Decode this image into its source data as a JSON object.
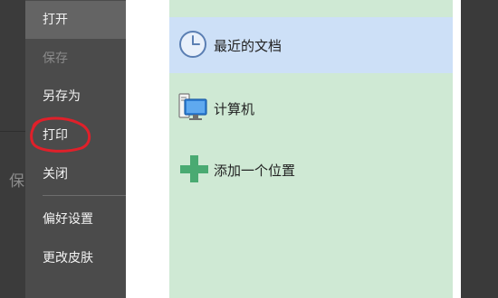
{
  "background_doc": {
    "partial_text": "保"
  },
  "file_menu": {
    "items": [
      {
        "label": "打开",
        "state": "active"
      },
      {
        "label": "保存",
        "state": "disabled"
      },
      {
        "label": "另存为",
        "state": "normal"
      },
      {
        "label": "打印",
        "state": "normal",
        "annotated": true
      },
      {
        "label": "关闭",
        "state": "normal"
      },
      {
        "label": "偏好设置",
        "state": "normal"
      },
      {
        "label": "更改皮肤",
        "state": "normal"
      }
    ]
  },
  "locations": {
    "items": [
      {
        "label": "最近的文档",
        "icon": "clock-icon",
        "selected": true
      },
      {
        "label": "计算机",
        "icon": "computer-icon",
        "selected": false
      },
      {
        "label": "添加一个位置",
        "icon": "plus-icon",
        "selected": false
      }
    ]
  },
  "colors": {
    "menu_bg": "#4b4b4b",
    "menu_active": "#646464",
    "panel_bg": "#cfe9d4",
    "selected_bg": "#cde0f7",
    "annotation": "#e0202a",
    "plus_green": "#4aaa72"
  }
}
